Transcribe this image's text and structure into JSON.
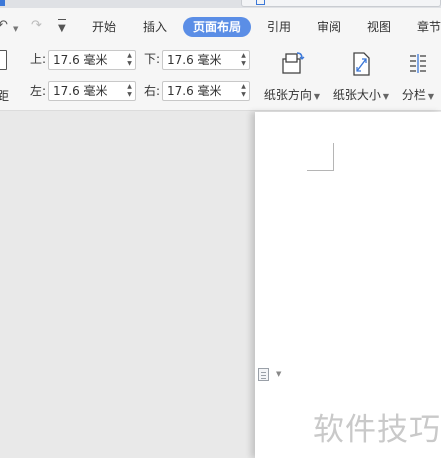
{
  "quick_access": {
    "undo_icon": "undo-icon",
    "redo_icon": "redo-icon",
    "customize_icon": "customize-quick-access-icon"
  },
  "menu": {
    "tabs": [
      {
        "label": "开始",
        "active": false
      },
      {
        "label": "插入",
        "active": false
      },
      {
        "label": "页面布局",
        "active": true
      },
      {
        "label": "引用",
        "active": false
      },
      {
        "label": "审阅",
        "active": false
      },
      {
        "label": "视图",
        "active": false
      },
      {
        "label": "章节",
        "active": false
      }
    ],
    "active_color": "#5b8ee6"
  },
  "margins": {
    "label": "距",
    "top_label": "上:",
    "top_value": "17.6 毫米",
    "bottom_label": "下:",
    "bottom_value": "17.6 毫米",
    "left_label": "左:",
    "left_value": "17.6 毫米",
    "right_label": "右:",
    "right_value": "17.6 毫米"
  },
  "tools": {
    "orientation_label": "纸张方向",
    "size_label": "纸张大小",
    "columns_label": "分栏"
  },
  "document": {
    "watermark": "软件技巧"
  }
}
